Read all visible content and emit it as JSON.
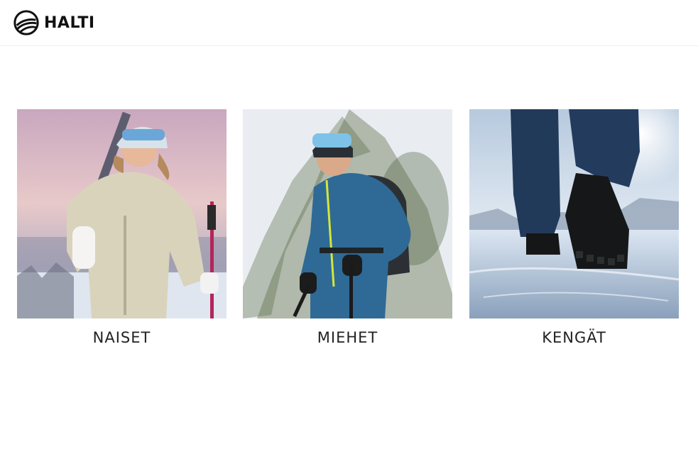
{
  "header": {
    "logo_text": "HALTI",
    "logo_icon": "halti-logo-icon"
  },
  "categories": [
    {
      "label": "NAISET",
      "image": "woman-skier-photo"
    },
    {
      "label": "MIEHET",
      "image": "man-hiker-photo"
    },
    {
      "label": "KENGÄT",
      "image": "winter-boots-photo"
    }
  ],
  "colors": {
    "text": "#222222",
    "divider": "#eeeeee",
    "background": "#ffffff"
  }
}
